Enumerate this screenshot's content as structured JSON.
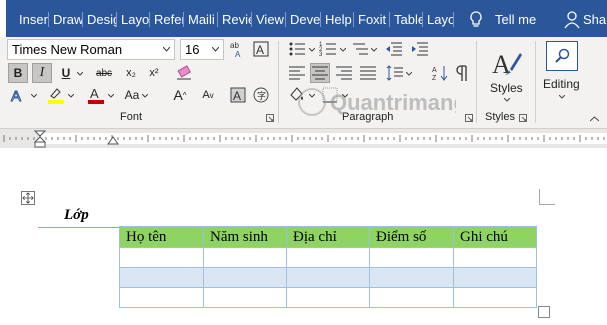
{
  "tabs": [
    {
      "label": "Inser"
    },
    {
      "label": "Draw"
    },
    {
      "label": "Desig"
    },
    {
      "label": "Layo"
    },
    {
      "label": "Refer"
    },
    {
      "label": "Maili"
    },
    {
      "label": "Revie"
    },
    {
      "label": "View"
    },
    {
      "label": "Deve"
    },
    {
      "label": "Help"
    },
    {
      "label": "Foxit"
    },
    {
      "label": "Table"
    },
    {
      "label": "Layo"
    }
  ],
  "tell_me": "Tell me",
  "share": "Shar",
  "font": {
    "name": "Times New Roman",
    "size": "16"
  },
  "groups": {
    "font": "Font",
    "paragraph": "Paragraph",
    "styles": "Styles"
  },
  "big_buttons": {
    "styles": "Styles",
    "editing": "Editing"
  },
  "font_buttons": {
    "bold": "B",
    "italic": "I",
    "underline": "U",
    "strike": "abc",
    "subscript": "x₂",
    "superscript": "x²",
    "aa": "Aa",
    "grow": "A",
    "shrink": "A"
  },
  "document": {
    "caption": "Lớp",
    "table": {
      "headers": [
        "Họ tên",
        "Năm sinh",
        "Địa chỉ",
        "Điểm số",
        "Ghi chú"
      ],
      "rows": [
        [
          "",
          "",
          "",
          "",
          ""
        ],
        [
          "",
          "",
          "",
          "",
          ""
        ],
        [
          "",
          "",
          "",
          "",
          ""
        ]
      ]
    }
  },
  "watermark": "Quantrimang",
  "colors": {
    "tabbar": "#2b579a",
    "ribbon": "#f3f2f1",
    "header_cell": "#8fd460",
    "banded_row": "#dae6f3",
    "highlight": "#ffff00",
    "font_color": "#c00000"
  },
  "icons": [
    "lightbulb-icon",
    "person-icon",
    "bullets-icon",
    "numbering-icon",
    "multilevel-list-icon",
    "decrease-indent-icon",
    "increase-indent-icon",
    "sort-icon",
    "show-marks-icon",
    "align-left-icon",
    "center-icon",
    "align-right-icon",
    "justify-icon",
    "line-spacing-icon",
    "shading-icon",
    "borders-icon",
    "styles-icon",
    "editing-icon",
    "text-effects-icon",
    "highlight-icon",
    "font-color-icon",
    "clear-format-icon",
    "table-move-icon",
    "table-resize-icon"
  ]
}
